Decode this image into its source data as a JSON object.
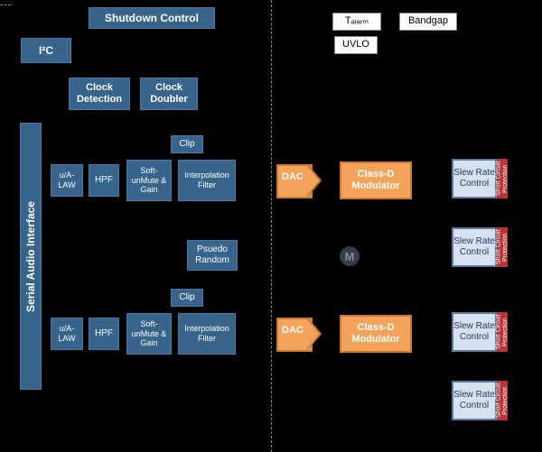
{
  "header": {
    "shutdown": "Shutdown Control",
    "t_alarm": "Tₐₗₐᵣₘ",
    "bandgap": "Bandgap",
    "uvlo": "UVLO"
  },
  "left_col": {
    "i2c": "I²C",
    "sai": "Serial Audio Interface",
    "clock_detection": "Clock Detection",
    "clock_doubler": "Clock Doubler"
  },
  "channel": {
    "clip": "Clip",
    "ua_law": "u/A-LAW",
    "hpf": "HPF",
    "soft_unmute": "Soft-unMute & Gain",
    "interp_filter": "Interpolation Filter",
    "dac": "DAC",
    "classd": "Class-D Modulator",
    "pseudo_random": "Psuedo Random"
  },
  "output": {
    "slew_rate": "Slew Rate Control",
    "short_circuit": "Short Circuit Protection"
  },
  "watermark": "M"
}
